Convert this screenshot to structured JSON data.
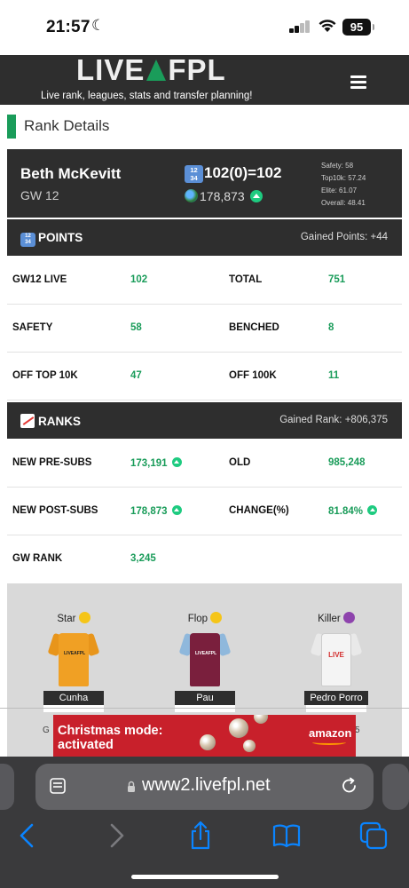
{
  "status_bar": {
    "time": "21:57",
    "battery": "95"
  },
  "header": {
    "logo_left": "LIVE",
    "logo_right": "FPL",
    "tagline": "Live rank, leagues, stats and transfer planning!"
  },
  "page": {
    "section_title": "Rank Details"
  },
  "profile": {
    "name": "Beth McKevitt",
    "gameweek": "GW 12",
    "score": "102(0)=102",
    "overall_rank": "178,873",
    "stats": [
      "Safety: 58",
      "Top10k: 57.24",
      "Elite: 61.07",
      "Overall: 48.41"
    ]
  },
  "points": {
    "title": "POINTS",
    "gained": "Gained Points: +44",
    "rows": [
      {
        "l1": "GW12 LIVE",
        "v1": "102",
        "l2": "TOTAL",
        "v2": "751"
      },
      {
        "l1": "SAFETY",
        "v1": "58",
        "l2": "BENCHED",
        "v2": "8"
      },
      {
        "l1": "OFF TOP 10K",
        "v1": "47",
        "l2": "OFF 100K",
        "v2": "11"
      }
    ]
  },
  "ranks": {
    "title": "RANKS",
    "gained": "Gained Rank: +806,375",
    "rows": [
      {
        "l1": "NEW PRE-SUBS",
        "v1": "173,191",
        "l2": "OLD",
        "v2": "985,248"
      },
      {
        "l1": "NEW POST-SUBS",
        "v1": "178,873",
        "l2": "CHANGE(%)",
        "v2": "81.84%"
      },
      {
        "l1": "GW RANK",
        "v1": "3,245",
        "l2": "",
        "v2": ""
      }
    ]
  },
  "players": [
    {
      "tag": "Star",
      "name": "Cunha",
      "kit_text": "LIVEAFPL",
      "color": "#f0a024"
    },
    {
      "tag": "Flop",
      "name": "Pau",
      "kit_text": "LIVEAFPL",
      "color": "#7a1f3d"
    },
    {
      "tag": "Killer",
      "name": "Pedro Porro",
      "kit_text": "LIVE",
      "color": "#f4f4f4"
    }
  ],
  "pitch_partial": {
    "left": "G",
    "right": "5"
  },
  "ad": {
    "title_line1": "Christmas mode:",
    "title_line2": "activated",
    "brand": "amazon"
  },
  "browser": {
    "url": "www2.livefpl.net"
  }
}
